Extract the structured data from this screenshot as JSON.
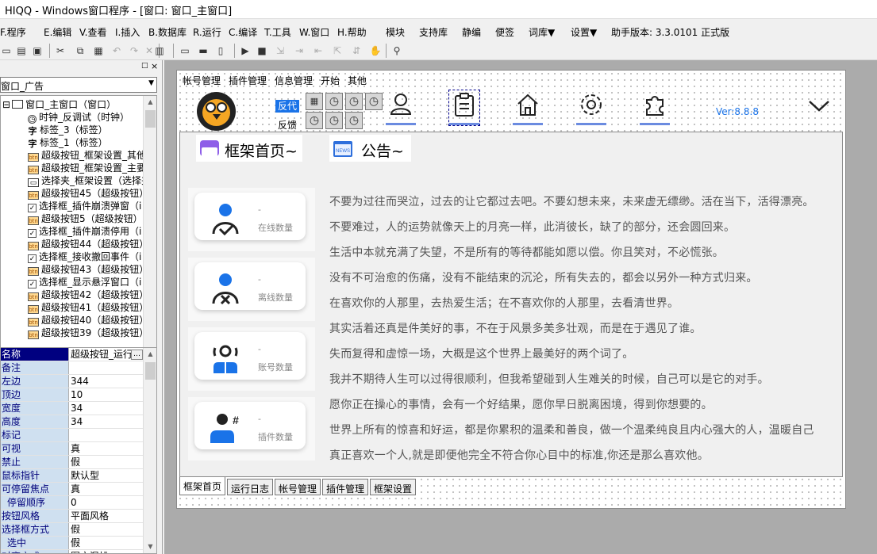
{
  "window": {
    "title": "HIQQ - Windows窗口程序 - [窗口: 窗口_主窗口]"
  },
  "menubar": {
    "items": [
      "F.程序",
      "E.编辑",
      "V.查看",
      "I.插入",
      "B.数据库",
      "R.运行",
      "C.编译",
      "T.工具",
      "W.窗口",
      "H.帮助",
      "模块",
      "支持库",
      "静编",
      "便签",
      "词库▼",
      "设置▼"
    ],
    "version_label": "助手版本: 3.3.0101 正式版"
  },
  "toolbar": {
    "icons": [
      "open-icon",
      "save-icon",
      "save-all-icon",
      "cut-icon",
      "copy-icon",
      "paste-icon",
      "undo-icon",
      "redo-icon",
      "close-icon",
      "preview-icon",
      "layout1-icon",
      "layout2-icon",
      "layout3-icon",
      "run-icon",
      "stop-icon",
      "step1-icon",
      "step2-icon",
      "step3-icon",
      "step4-icon",
      "hand-icon",
      "find-icon"
    ]
  },
  "leftpanel": {
    "combo_value": "窗口_广告",
    "tree": [
      {
        "label": "窗口_主窗口（窗口）",
        "icon": "window"
      },
      {
        "label": "时钟_反调试（时钟）",
        "icon": "clock"
      },
      {
        "label": "标签_3（标签）",
        "icon": "label"
      },
      {
        "label": "标签_1（标签）",
        "icon": "label"
      },
      {
        "label": "超级按钮_框架设置_其他",
        "icon": "button"
      },
      {
        "label": "超级按钮_框架设置_主要",
        "icon": "button"
      },
      {
        "label": "选择夹_框架设置（选择夹",
        "icon": "tab"
      },
      {
        "label": "超级按钮45（超级按钮）",
        "icon": "button"
      },
      {
        "label": "选择框_插件崩溃弹窗（i",
        "icon": "check"
      },
      {
        "label": "超级按钮5（超级按钮）",
        "icon": "button"
      },
      {
        "label": "选择框_插件崩溃停用（i",
        "icon": "check"
      },
      {
        "label": "超级按钮44（超级按钮）",
        "icon": "button"
      },
      {
        "label": "选择框_接收撤回事件（i",
        "icon": "check"
      },
      {
        "label": "超级按钮43（超级按钮）",
        "icon": "button"
      },
      {
        "label": "选择框_显示悬浮窗口（i",
        "icon": "check"
      },
      {
        "label": "超级按钮42（超级按钮）",
        "icon": "button"
      },
      {
        "label": "超级按钮41（超级按钮）",
        "icon": "button"
      },
      {
        "label": "超级按钮40（超级按钮）",
        "icon": "button"
      },
      {
        "label": "超级按钮39（超级按钮）",
        "icon": "button"
      }
    ],
    "props": [
      {
        "name": "名称",
        "value": "超级按钮_运行"
      },
      {
        "name": "备注",
        "value": ""
      },
      {
        "name": "左边",
        "value": "344"
      },
      {
        "name": "顶边",
        "value": "10"
      },
      {
        "name": "宽度",
        "value": "34"
      },
      {
        "name": "高度",
        "value": "34"
      },
      {
        "name": "标记",
        "value": ""
      },
      {
        "name": "可视",
        "value": "真"
      },
      {
        "name": "禁止",
        "value": "假"
      },
      {
        "name": "鼠标指针",
        "value": "默认型"
      },
      {
        "name": "可停留焦点",
        "value": "真"
      },
      {
        "name": "停留顺序",
        "value": "0"
      },
      {
        "name": "按钮风格",
        "value": "平面风格"
      },
      {
        "name": "选择框方式",
        "value": "假"
      },
      {
        "name": "选中",
        "value": "假"
      },
      {
        "name": "对齐方式",
        "value": "图文混排"
      }
    ]
  },
  "form": {
    "menu": [
      "帐号管理",
      "插件管理",
      "信息管理",
      "开始",
      "其他"
    ],
    "fandai": "反代",
    "fankui": "反馈",
    "version": "Ver:8.8.8",
    "home_title": "框架首页~",
    "announce_title": "公告~",
    "cards": [
      {
        "value": "-",
        "label": "在线数量",
        "icon": "user-check-icon"
      },
      {
        "value": "-",
        "label": "离线数量",
        "icon": "user-x-icon"
      },
      {
        "value": "-",
        "label": "账号数量",
        "icon": "users-icon"
      },
      {
        "value": "-",
        "label": "插件数量",
        "icon": "user-hash-icon"
      }
    ],
    "announcements": [
      "不要为过往而哭泣，过去的让它都过去吧。不要幻想未来，未来虚无缥缈。活在当下，活得漂亮。",
      "不要难过，人的运势就像天上的月亮一样，此消彼长，缺了的部分，还会圆回来。",
      "生活中本就充满了失望，不是所有的等待都能如愿以偿。你且笑对，不必慌张。",
      "没有不可治愈的伤痛，没有不能结束的沉沦，所有失去的，都会以另外一种方式归来。",
      "在喜欢你的人那里，去热爱生活；在不喜欢你的人那里，去看清世界。",
      "其实活着还真是件美好的事，不在于风景多美多壮观，而是在于遇见了谁。",
      "失而复得和虚惊一场，大概是这个世界上最美好的两个词了。",
      "我并不期待人生可以过得很顺利，但我希望碰到人生难关的时候，自己可以是它的对手。",
      "愿你正在操心的事情，会有一个好结果，愿你早日脱离困境，得到你想要的。",
      "世界上所有的惊喜和好运，都是你累积的温柔和善良，做一个温柔纯良且内心强大的人，温暖自己",
      "真正喜欢一个人,就是即便他完全不符合你心目中的标准,你还是那么喜欢他。"
    ],
    "tabs": [
      "框架首页",
      "运行日志",
      "帐号管理",
      "插件管理",
      "框架设置"
    ]
  }
}
